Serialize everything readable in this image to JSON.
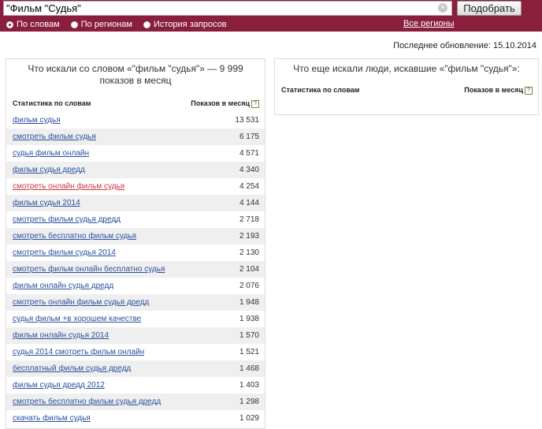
{
  "search": {
    "query": "\"Фильм \"Судья\"",
    "clear_glyph": "×",
    "button_label": "Подобрать"
  },
  "modes": [
    {
      "label": "По словам",
      "selected": true
    },
    {
      "label": "По регионам",
      "selected": false
    },
    {
      "label": "История запросов",
      "selected": false
    }
  ],
  "all_regions": "Все регионы",
  "updated": "Последнее обновление: 15.10.2014",
  "left_panel": {
    "title": "Что искали со словом «\"фильм \"судья\"» — 9 999 показов в месяц",
    "col_words": "Статистика по словам",
    "col_shows": "Показов в месяц",
    "help": "?",
    "rows": [
      {
        "phrase": "фильм судья",
        "count": "13 531",
        "visited": false
      },
      {
        "phrase": "смотреть фильм судья",
        "count": "6 175",
        "visited": false
      },
      {
        "phrase": "судья фильм онлайн",
        "count": "4 571",
        "visited": false
      },
      {
        "phrase": "фильм судья дредд",
        "count": "4 340",
        "visited": false
      },
      {
        "phrase": "смотреть онлайн фильм судья",
        "count": "4 254",
        "visited": true
      },
      {
        "phrase": "фильм судья 2014",
        "count": "4 144",
        "visited": false
      },
      {
        "phrase": "смотреть фильм судья дредд",
        "count": "2 718",
        "visited": false
      },
      {
        "phrase": "смотреть бесплатно фильм судья",
        "count": "2 193",
        "visited": false
      },
      {
        "phrase": "смотреть фильм судья 2014",
        "count": "2 130",
        "visited": false
      },
      {
        "phrase": "смотреть фильм онлайн бесплатно судья",
        "count": "2 104",
        "visited": false
      },
      {
        "phrase": "фильм онлайн судья дредд",
        "count": "2 076",
        "visited": false
      },
      {
        "phrase": "смотреть онлайн фильм судья дредд",
        "count": "1 948",
        "visited": false
      },
      {
        "phrase": "судья фильм +в хорошем качестве",
        "count": "1 938",
        "visited": false
      },
      {
        "phrase": "фильм онлайн судья 2014",
        "count": "1 570",
        "visited": false
      },
      {
        "phrase": "судья 2014 смотреть фильм онлайн",
        "count": "1 521",
        "visited": false
      },
      {
        "phrase": "бесплатный фильм судья дредд",
        "count": "1 468",
        "visited": false
      },
      {
        "phrase": "фильм судья дредд 2012",
        "count": "1 403",
        "visited": false
      },
      {
        "phrase": "смотреть бесплатно фильм судья дредд",
        "count": "1 298",
        "visited": false
      },
      {
        "phrase": "скачать фильм судья",
        "count": "1 029",
        "visited": false
      }
    ]
  },
  "right_panel": {
    "title": "Что еще искали люди, искавшие «\"фильм \"судья\"»:",
    "col_words": "Статистика по словам",
    "col_shows": "Показов в месяц",
    "help": "?"
  }
}
